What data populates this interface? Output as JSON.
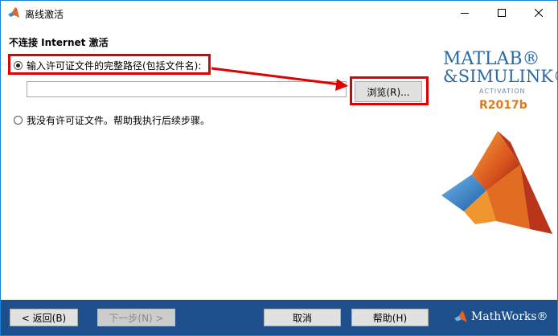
{
  "window": {
    "title": "离线激活",
    "minimize_icon": "minimize-icon",
    "maximize_icon": "maximize-icon",
    "close_icon": "close-icon"
  },
  "main": {
    "heading": "不连接 Internet 激活",
    "options": [
      {
        "label": "输入许可证文件的完整路径(包括文件名):",
        "selected": true
      },
      {
        "label": "我没有许可证文件。帮助我执行后续步骤。",
        "selected": false
      }
    ],
    "path_input": {
      "value": "",
      "placeholder": ""
    },
    "browse_label": "浏览(R)..."
  },
  "brand": {
    "line1": "MATLAB®",
    "line2": "&SIMULINK®",
    "activation": "ACTIVATION",
    "release": "R2017b",
    "vendor": "MathWorks®"
  },
  "footer": {
    "back_label": "< 返回(B)",
    "next_label": "下一步(N) >",
    "cancel_label": "取消",
    "help_label": "帮助(H)"
  },
  "colors": {
    "highlight": "#e10000",
    "footer_bg": "#1d4f8c",
    "window_border": "#1883d7"
  }
}
